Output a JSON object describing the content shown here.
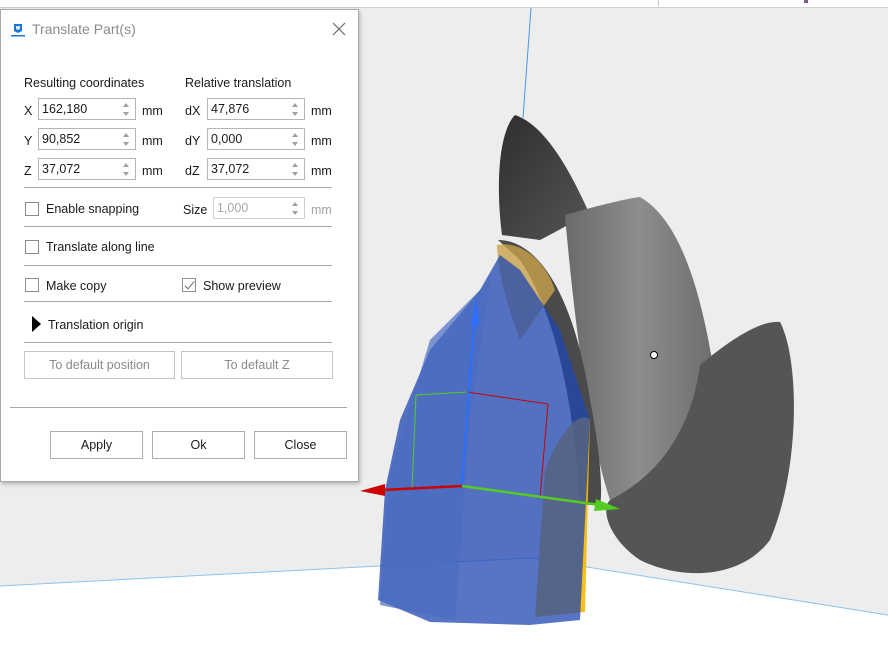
{
  "dialog": {
    "title": "Translate Part(s)",
    "icon": "app-logo-icon",
    "close_icon": "close-icon",
    "resulting_coordinates": {
      "heading": "Resulting coordinates",
      "fields": [
        {
          "axis": "X",
          "value": "162,180",
          "unit": "mm"
        },
        {
          "axis": "Y",
          "value": "90,852",
          "unit": "mm"
        },
        {
          "axis": "Z",
          "value": "37,072",
          "unit": "mm"
        }
      ]
    },
    "relative_translation": {
      "heading": "Relative translation",
      "fields": [
        {
          "axis": "dX",
          "value": "47,876",
          "unit": "mm"
        },
        {
          "axis": "dY",
          "value": "0,000",
          "unit": "mm"
        },
        {
          "axis": "dZ",
          "value": "37,072",
          "unit": "mm"
        }
      ]
    },
    "enable_snapping": {
      "label": "Enable snapping",
      "checked": false
    },
    "snap_size": {
      "label": "Size",
      "value": "1,000",
      "unit": "mm",
      "disabled": true
    },
    "translate_along_line": {
      "label": "Translate along line",
      "checked": false
    },
    "make_copy": {
      "label": "Make copy",
      "checked": false
    },
    "show_preview": {
      "label": "Show preview",
      "checked": true
    },
    "translation_origin": {
      "label": "Translation origin",
      "expanded": false
    },
    "to_default_position": "To default position",
    "to_default_z": "To default Z",
    "buttons": {
      "apply": "Apply",
      "ok": "Ok",
      "close": "Close"
    }
  },
  "viewport": {
    "background": "#ededed",
    "floor": "#ffffff",
    "axis_colors": {
      "x": "#cc0000",
      "y": "#55cc22",
      "z": "#2a6fff"
    },
    "model_color": "#5a5a5a",
    "support_color": "#f5b800",
    "preview_color": "#2a4fb8"
  }
}
